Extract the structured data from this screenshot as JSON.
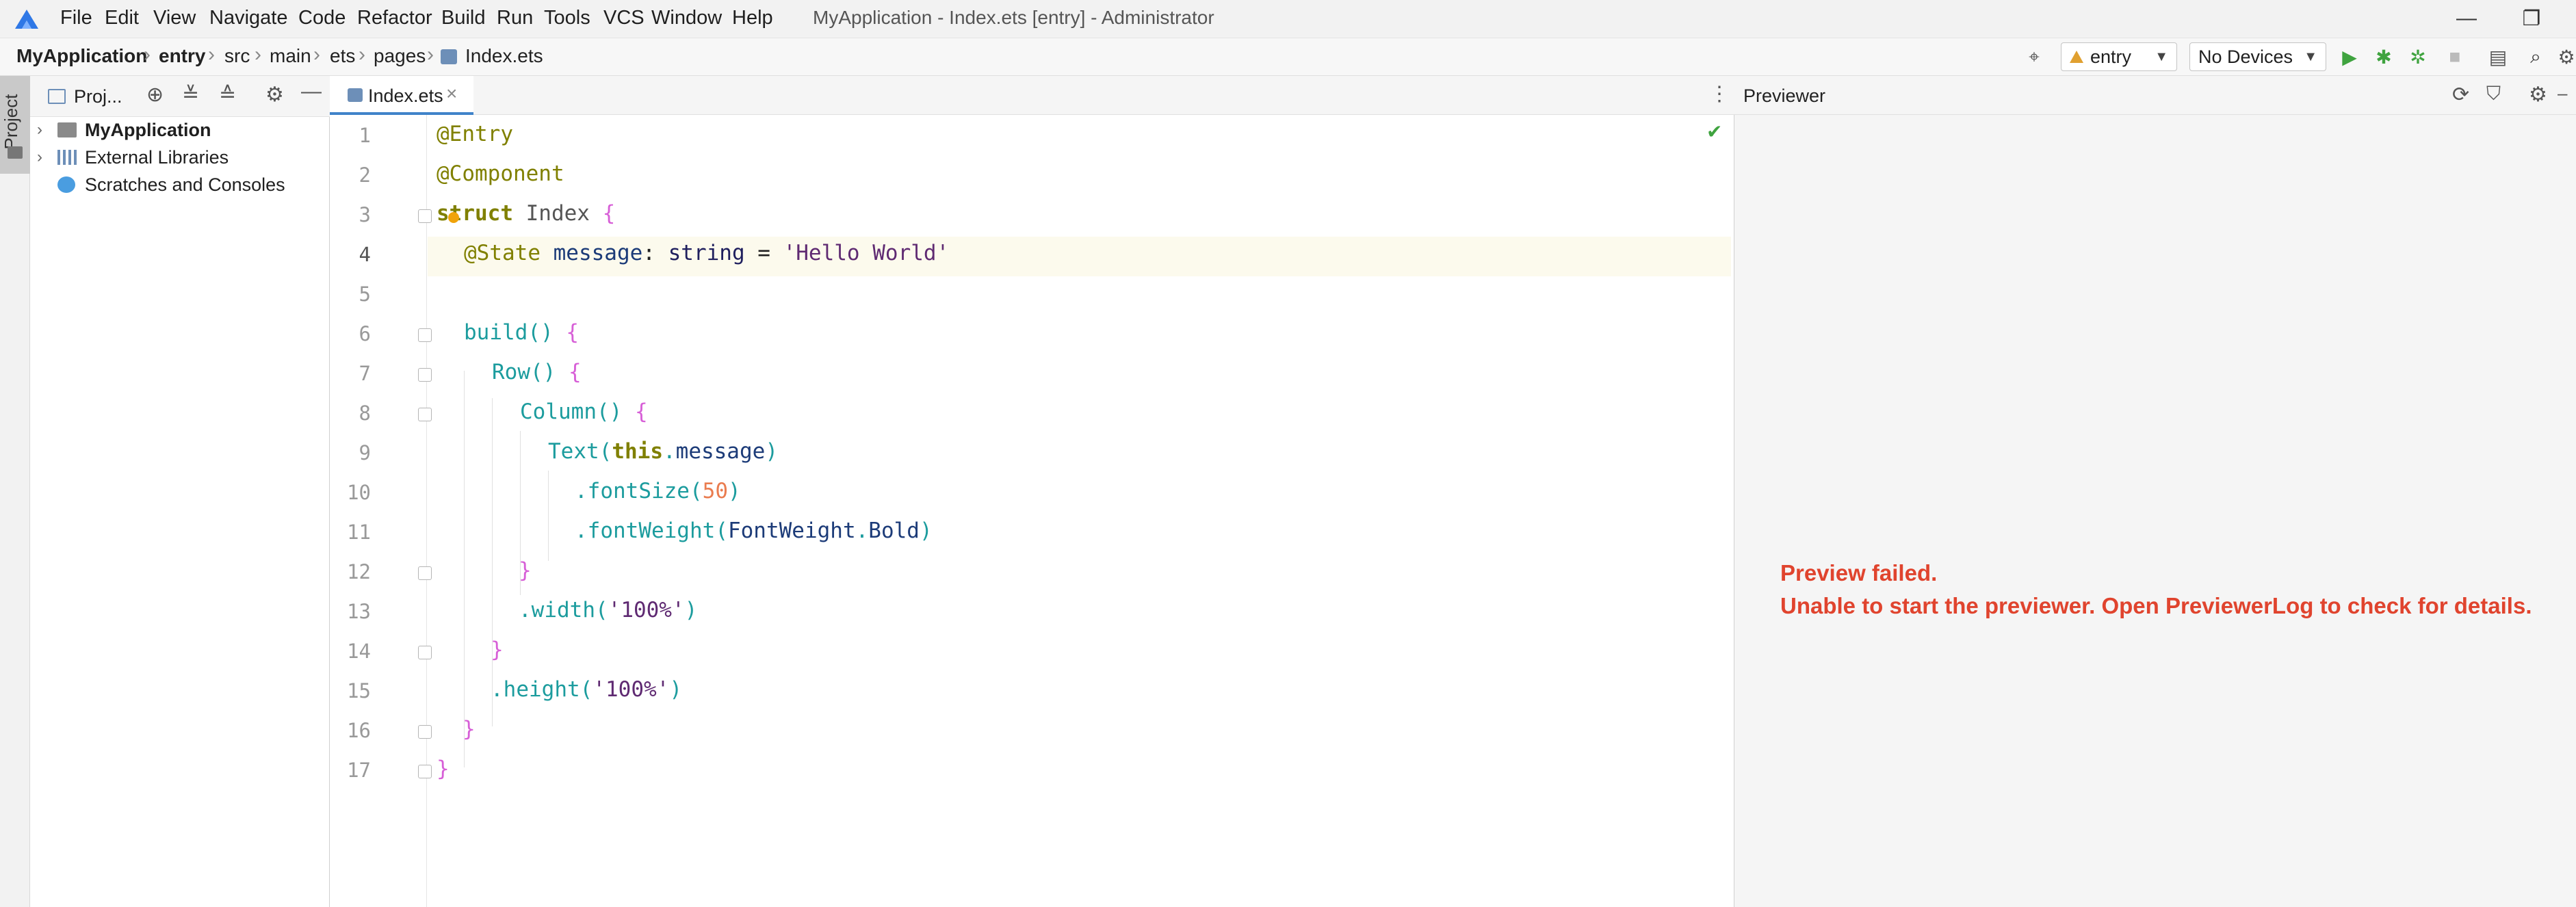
{
  "window": {
    "title": "MyApplication - Index.ets [entry] - Administrator",
    "menu": [
      "File",
      "Edit",
      "View",
      "Navigate",
      "Code",
      "Refactor",
      "Build",
      "Run",
      "Tools",
      "VCS",
      "Window",
      "Help"
    ],
    "controls": {
      "minimize": "—",
      "restore": "❐"
    }
  },
  "breadcrumb": [
    "MyApplication",
    "entry",
    "src",
    "main",
    "ets",
    "pages",
    "Index.ets"
  ],
  "toolbar": {
    "module_select": "entry",
    "device_select": "No Devices",
    "icons": [
      "target-icon",
      "run-icon",
      "debug-icon",
      "profile-icon",
      "stop-icon",
      "device-manager-icon",
      "search-icon",
      "settings-icon"
    ]
  },
  "sidebar": {
    "tab_label": "Project"
  },
  "project_panel": {
    "title": "Proj...",
    "tree": [
      {
        "label": "MyApplication",
        "bold": true,
        "expandable": true
      },
      {
        "label": "External Libraries",
        "bold": false,
        "expandable": true
      },
      {
        "label": "Scratches and Consoles",
        "bold": false,
        "expandable": false
      }
    ]
  },
  "editor": {
    "tab_label": "Index.ets",
    "tab_close": "×",
    "options": "⋮",
    "check": "✔",
    "line_numbers": [
      "1",
      "2",
      "3",
      "4",
      "5",
      "6",
      "7",
      "8",
      "9",
      "10",
      "11",
      "12",
      "13",
      "14",
      "15",
      "16",
      "17"
    ],
    "code": {
      "l1": "@Entry",
      "l2": "@Component",
      "l3_kw": "struct",
      "l3_name": " Index ",
      "l3_brace": "{",
      "l4_anno": "@State",
      "l4_name": " message",
      "l4_colon": ": ",
      "l4_type": "string",
      "l4_eq": " = ",
      "l4_str": "'Hello World'",
      "l6_fn": "build",
      "l6_paren": "() ",
      "l6_brace": "{",
      "l7_fn": "Row",
      "l7_paren": "() ",
      "l7_brace": "{",
      "l8_fn": "Column",
      "l8_paren": "() ",
      "l8_brace": "{",
      "l9_fn": "Text",
      "l9_open": "(",
      "l9_this": "this",
      "l9_dot": ".",
      "l9_prop": "message",
      "l9_close": ")",
      "l10_fn": ".fontSize",
      "l10_open": "(",
      "l10_num": "50",
      "l10_close": ")",
      "l11_fn": ".fontWeight",
      "l11_open": "(",
      "l11_type": "FontWeight",
      "l11_dot": ".",
      "l11_val": "Bold",
      "l11_close": ")",
      "l12": "}",
      "l13_fn": ".width",
      "l13_open": "(",
      "l13_str": "'100%'",
      "l13_close": ")",
      "l14": "}",
      "l15_fn": ".height",
      "l15_open": "(",
      "l15_str": "'100%'",
      "l15_close": ")",
      "l16": "}",
      "l17": "}"
    }
  },
  "previewer": {
    "title": "Previewer",
    "error_line1": "Preview failed.",
    "error_line2": "Unable to start the previewer. Open PreviewerLog to check for details."
  },
  "colors": {
    "accent": "#4083c9",
    "error": "#e0442e",
    "run": "#3fa33f",
    "caret_line": "#fcfaed"
  }
}
